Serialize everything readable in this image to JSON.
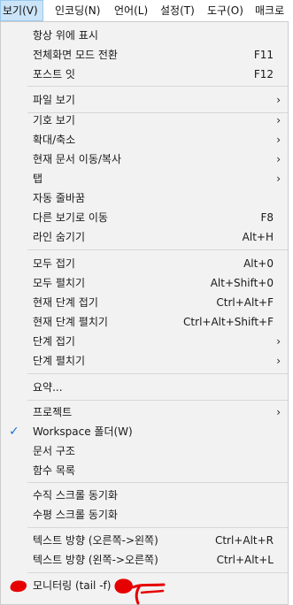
{
  "menubar": {
    "items": [
      {
        "label": "보기(V)",
        "active": true
      },
      {
        "label": "인코딩(N)"
      },
      {
        "label": "언어(L)"
      },
      {
        "label": "설정(T)"
      },
      {
        "label": "도구(O)"
      },
      {
        "label": "매크로"
      }
    ]
  },
  "menu": {
    "items": [
      {
        "label": "항상 위에 표시"
      },
      {
        "label": "전체화면 모드 전환",
        "shortcut": "F11"
      },
      {
        "label": "포스트 잇",
        "shortcut": "F12"
      },
      {
        "label": "파일 보기",
        "submenu": true
      },
      {
        "label": "기호 보기",
        "submenu": true
      },
      {
        "label": "확대/축소",
        "submenu": true
      },
      {
        "label": "현재 문서 이동/복사",
        "submenu": true
      },
      {
        "label": "탭",
        "submenu": true
      },
      {
        "label": "자동 줄바꿈"
      },
      {
        "label": "다른 보기로 이동",
        "shortcut": "F8"
      },
      {
        "label": "라인 숨기기",
        "shortcut": "Alt+H"
      },
      {
        "label": "모두 접기",
        "shortcut": "Alt+0"
      },
      {
        "label": "모두 펼치기",
        "shortcut": "Alt+Shift+0"
      },
      {
        "label": "현재 단계 접기",
        "shortcut": "Ctrl+Alt+F"
      },
      {
        "label": "현재 단계 펼치기",
        "shortcut": "Ctrl+Alt+Shift+F"
      },
      {
        "label": "단계 접기",
        "submenu": true
      },
      {
        "label": "단계 펼치기",
        "submenu": true
      },
      {
        "label": "요약..."
      },
      {
        "label": "프로젝트",
        "submenu": true
      },
      {
        "label": "Workspace 폴더(W)",
        "checked": true
      },
      {
        "label": "문서 구조"
      },
      {
        "label": "함수 목록"
      },
      {
        "label": "수직 스크롤 동기화"
      },
      {
        "label": "수평 스크롤 동기화"
      },
      {
        "label": "텍스트 방향 (오른쪽->왼쪽)",
        "shortcut": "Ctrl+Alt+R"
      },
      {
        "label": "텍스트 방향 (왼쪽->오른쪽)",
        "shortcut": "Ctrl+Alt+L"
      },
      {
        "label": "모니터링 (tail -f)"
      }
    ],
    "submenu_arrow": "›",
    "check_mark": "✓"
  },
  "colors": {
    "menu_bg": "#f2f2f2",
    "active_menubar_bg": "#cce4f7",
    "check": "#1a73d9",
    "annotation": "#e60000"
  },
  "icons": [
    "submenu-arrow-icon",
    "check-icon"
  ]
}
